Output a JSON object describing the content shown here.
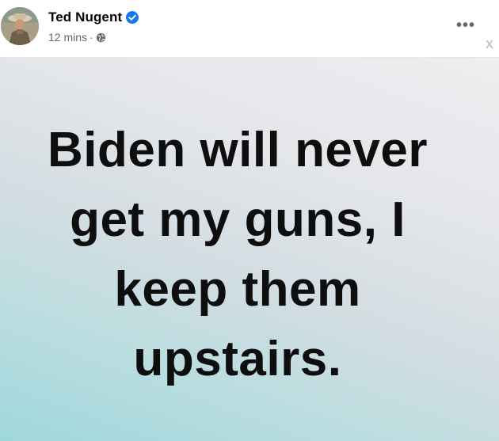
{
  "post": {
    "author": "Ted Nugent",
    "time": "12 mins",
    "separator": "·",
    "privacy_icon": "globe-icon",
    "verified_icon": "verified-badge-icon",
    "more_label": "•••",
    "close_label": "x"
  },
  "image": {
    "lines": [
      "Biden will never",
      "get my guns, I",
      "keep them",
      "upstairs."
    ]
  },
  "colors": {
    "name": "#050505",
    "meta": "#65676b",
    "verified": "#1877f2",
    "text": "#0e0e0e"
  }
}
